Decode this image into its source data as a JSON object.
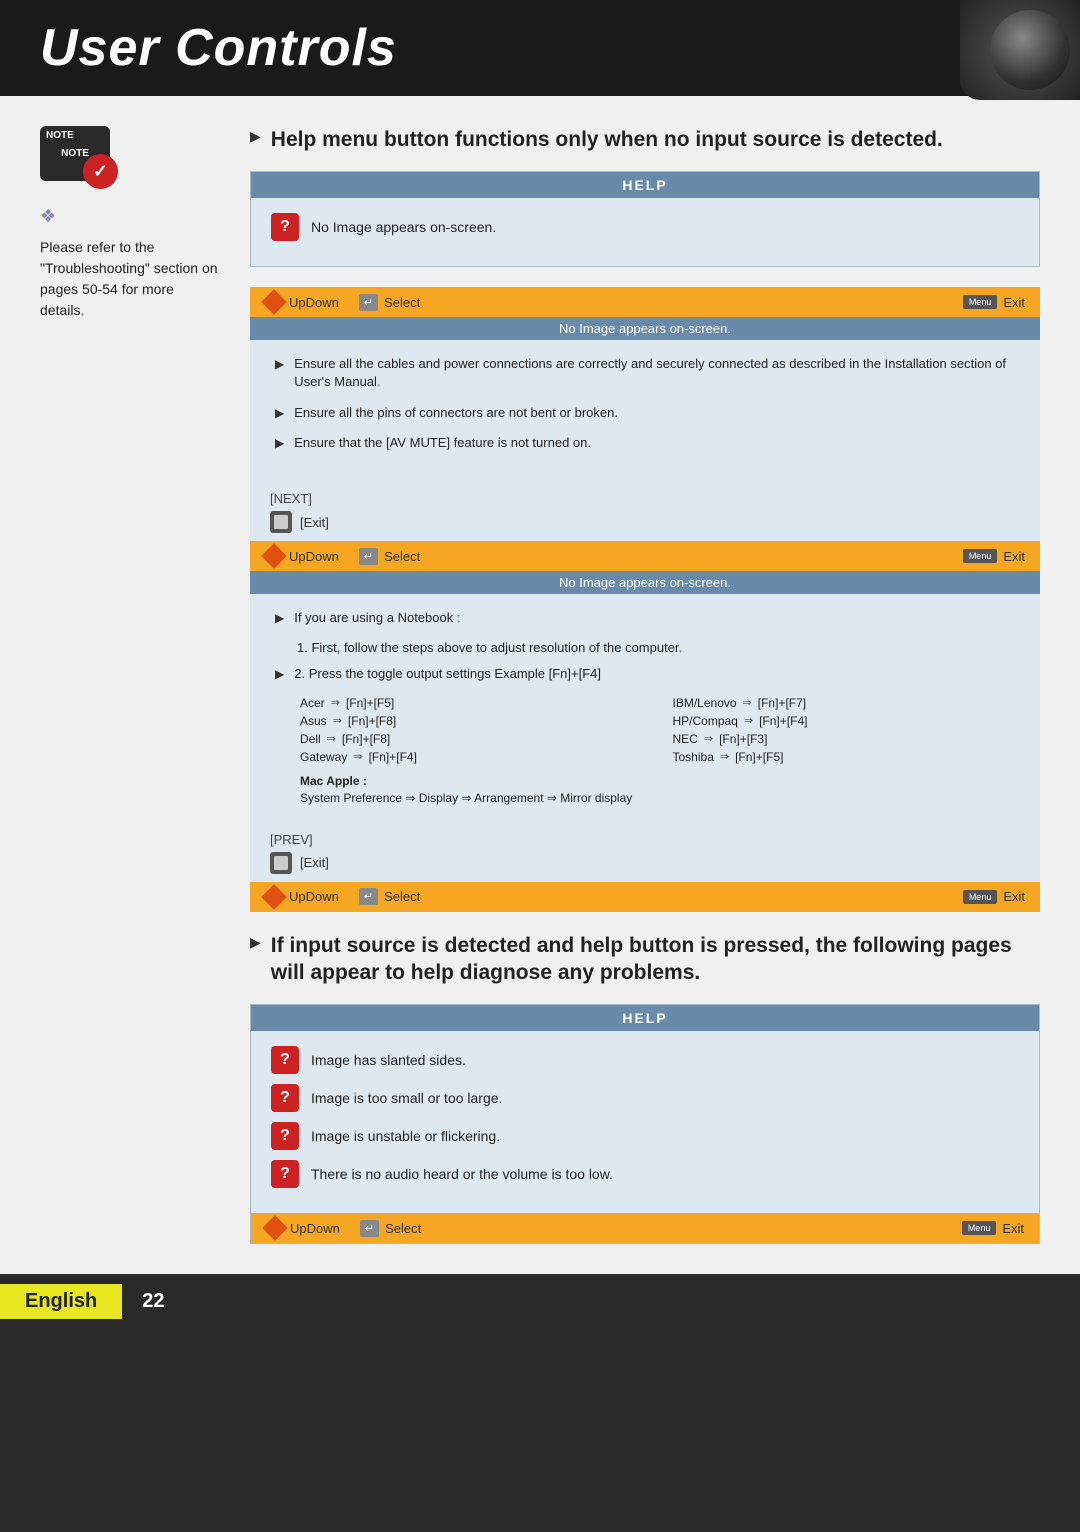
{
  "header": {
    "title": "User Controls"
  },
  "sidebar": {
    "note_label": "NOTE",
    "note_text": "Please refer to the \"Troubleshooting\" section on pages 50-54 for more details.",
    "diamond_symbol": "❖"
  },
  "section1": {
    "bullet_text": "Help menu button functions only when no input source is detected.",
    "help_title": "HELP",
    "help_item": "No Image appears on-screen.",
    "nav1": {
      "updown": "UpDown",
      "select": "Select",
      "exit": "Exit"
    },
    "status1": "No Image appears on-screen.",
    "content_bullets": [
      "Ensure all the cables and power connections are correctly and securely connected as described in the Installation section of User's Manual.",
      "Ensure all the pins of connectors are not bent or broken.",
      "Ensure that the [AV MUTE] feature is not turned on."
    ],
    "next_label": "[NEXT]",
    "exit_label": "[Exit]",
    "nav2": {
      "updown": "UpDown",
      "select": "Select",
      "exit": "Exit"
    },
    "status2": "No Image appears on-screen.",
    "notebook_heading": "If you are using a Notebook :",
    "notebook_step1": "1. First, follow the steps above to adjust resolution of the computer.",
    "notebook_step2": "2. Press the toggle output settings  Example  [Fn]+[F4]",
    "brands": [
      {
        "name": "Acer",
        "key": "[Fn]+[F5]"
      },
      {
        "name": "IBM/Lenovo",
        "key": "[Fn]+[F7]"
      },
      {
        "name": "Asus",
        "key": "[Fn]+[F8]"
      },
      {
        "name": "HP/Compaq",
        "key": "[Fn]+[F4]"
      },
      {
        "name": "Dell",
        "key": "[Fn]+[F8]"
      },
      {
        "name": "NEC",
        "key": "[Fn]+[F3]"
      },
      {
        "name": "Gateway",
        "key": "[Fn]+[F4]"
      },
      {
        "name": "Toshiba",
        "key": "[Fn]+[F5]"
      }
    ],
    "mac_label": "Mac Apple :",
    "mac_preference": "System Preference ⇒ Display ⇒ Arrangement ⇒ Mirror display",
    "prev_label": "[PREV]",
    "exit_label2": "[Exit]",
    "nav3": {
      "updown": "UpDown",
      "select": "Select",
      "exit": "Exit"
    }
  },
  "section2": {
    "bullet_text": "If input source is detected and help button is pressed, the following pages will appear to help diagnose any problems.",
    "help_title": "HELP",
    "help_items": [
      "Image has slanted sides.",
      "Image is too small or too large.",
      "Image is unstable or flickering.",
      "There is no audio heard or the volume is too low."
    ],
    "nav": {
      "updown": "UpDown",
      "select": "Select",
      "exit": "Exit"
    }
  },
  "footer": {
    "language": "English",
    "page_number": "22"
  }
}
